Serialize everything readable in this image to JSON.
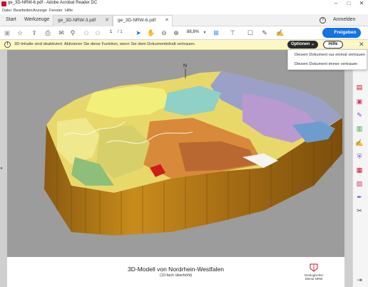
{
  "window": {
    "title": "ge_3D-NRW-6.pdf - Adobe Acrobat Reader DC"
  },
  "menu": [
    "Datei",
    "Bearbeiten",
    "Anzeige",
    "Fenster",
    "Hilfe"
  ],
  "tabs": {
    "home": "Start",
    "tools": "Werkzeuge",
    "doc1": "ge_3D-NRW-3.pdf",
    "doc2": "ge_3D-NRW-6.pdf",
    "sign_in": "Anmelden"
  },
  "toolbar": {
    "page_current": "1",
    "page_total": "/ 1",
    "zoom": "88,8%",
    "share": "Freigeben"
  },
  "message": {
    "text": "3D-Inhalte sind deaktiviert. Aktivieren Sie diese Funktion, wenn Sie dem Dokumentinhalt vertrauen.",
    "options": "Optionen",
    "help": "Hilfe"
  },
  "dropdown": {
    "item1": "Diesem Dokument nur einmal vertrauen",
    "item2": "Diesem Dokument immer vertrauen"
  },
  "document": {
    "north": "N",
    "title": "3D-Modell von Nordrhein-Westfalen",
    "subtitle": "(10-fach überhöht)",
    "logo_text": "Geologischer Dienst NRW"
  },
  "colors": {
    "accent": "#1473e6",
    "msgbar": "#fdf7c6",
    "pdf_red": "#c8102e"
  }
}
